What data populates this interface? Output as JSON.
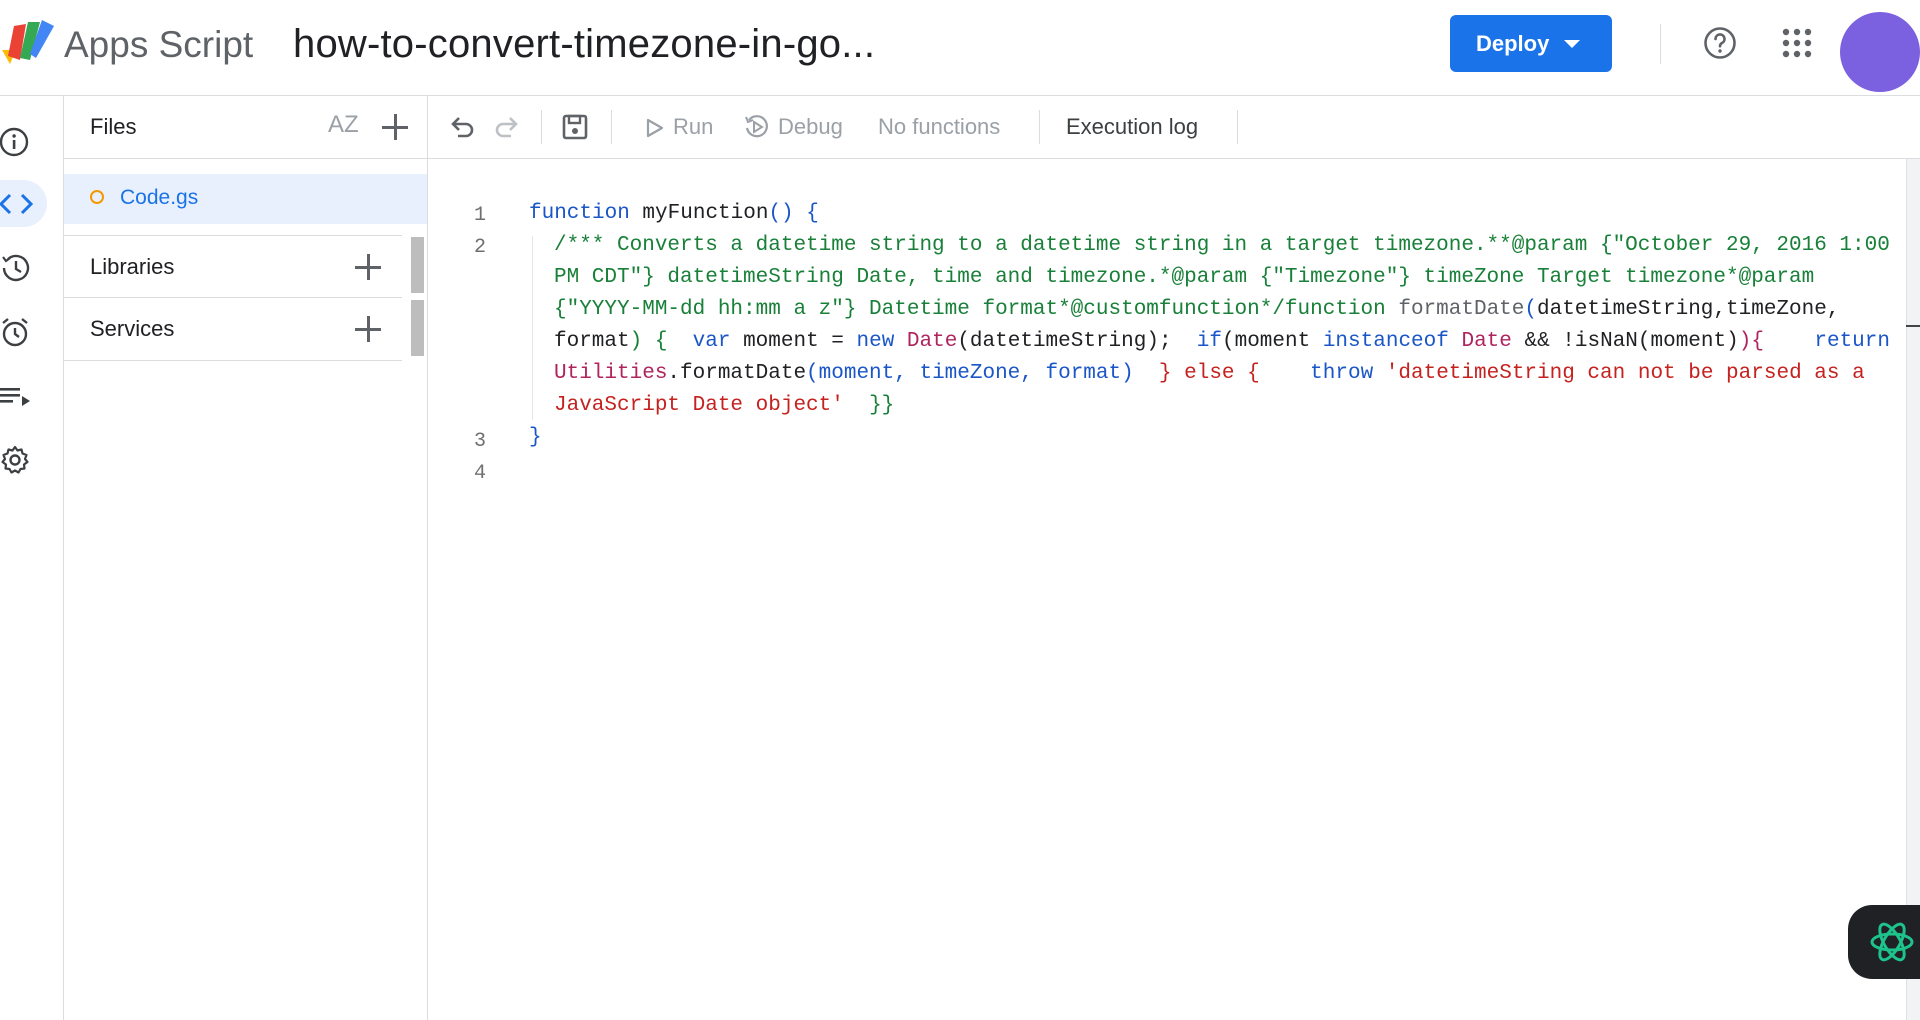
{
  "header": {
    "app_name": "Apps Script",
    "project_title": "how-to-convert-timezone-in-go...",
    "deploy_label": "Deploy",
    "icons": [
      "apps-script-logo",
      "help-icon",
      "apps-grid-icon",
      "avatar"
    ],
    "colors": {
      "deploy_bg": "#1a73e8",
      "avatar": "#7b61e0"
    }
  },
  "rail": {
    "items": [
      "info-icon",
      "code-icon",
      "history-icon",
      "triggers-icon",
      "executions-icon",
      "settings-icon"
    ],
    "active": "code-icon"
  },
  "files_panel": {
    "title": "Files",
    "sort_label": "AZ",
    "files": [
      {
        "name": "Code.gs",
        "selected": true
      }
    ],
    "sections": [
      {
        "label": "Libraries"
      },
      {
        "label": "Services"
      }
    ]
  },
  "toolbar": {
    "run_label": "Run",
    "debug_label": "Debug",
    "function_select": "No functions",
    "execution_log_label": "Execution log"
  },
  "editor": {
    "line_numbers": [
      "1",
      "2",
      "3",
      "4"
    ],
    "line1": {
      "kw": "function",
      "name": " myFunction",
      "paren": "() {"
    },
    "line2": {
      "comment_a": "/*** Converts a datetime string to a datetime string in a target timezone.**@param {\"October 29, 2016 1:00",
      "comment_b": "PM CDT\"} datetimeString Date, time and timezone.*@param {\"Timezone\"} timeZone Target timezone*@param",
      "comment_c": "{\"YYYY-MM-dd hh:mm a z\"} Datetime format*@customfunction*/function",
      "fn_name": " formatDate",
      "args_c": "(",
      "args_c2": "datetimeString,timeZone,",
      "w4_format": "format",
      "w4_paren": ") {",
      "w4_var": "var",
      "w4_moment": " moment = ",
      "w4_new": "new",
      "w4_date": " Date",
      "w4_arg": "(datetimeString);  ",
      "w4_if": "if",
      "w4_ifarg": "(moment ",
      "w4_instanceof": "instanceof",
      "w4_date2": " Date",
      "w4_and": " && !isNaN(moment)",
      "w4_close": "){",
      "w4_return": "return",
      "w5_util": "Utilities",
      "w5_fmt": ".formatDate",
      "w5_args": "(moment, timeZone, format)",
      "w5_else": "} else {",
      "w5_throw": "throw",
      "w5_str": "'datetimeString can not be parsed as a",
      "w6_str": "JavaScript Date object'",
      "w6_close": "}}"
    },
    "line3": {
      "brace": "}"
    }
  }
}
